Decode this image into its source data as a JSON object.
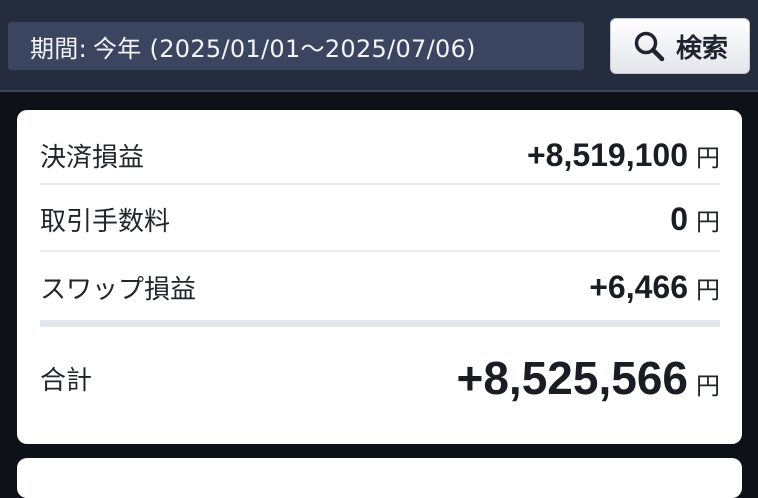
{
  "header": {
    "period_label": "期間:",
    "period_value": "今年 (2025/01/01〜2025/07/06)",
    "search_label": "検索",
    "search_icon": "magnifier-icon"
  },
  "summary": {
    "rows": [
      {
        "label": "決済損益",
        "value": "+8,519,100",
        "unit": "円"
      },
      {
        "label": "取引手数料",
        "value": "0",
        "unit": "円"
      },
      {
        "label": "スワップ損益",
        "value": "+6,466",
        "unit": "円"
      }
    ],
    "total": {
      "label": "合計",
      "value": "+8,525,566",
      "unit": "円"
    }
  }
}
